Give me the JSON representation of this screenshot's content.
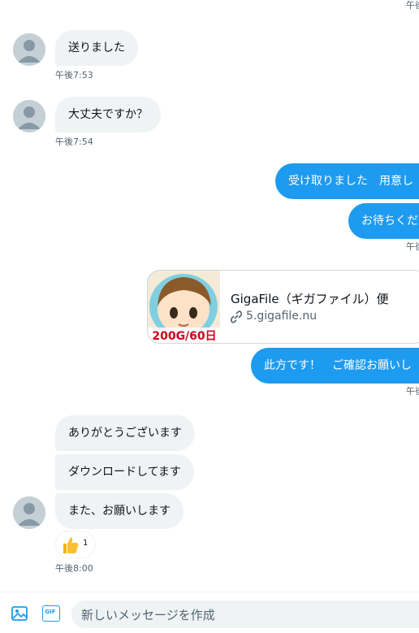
{
  "colors": {
    "accent": "#1d9bf0",
    "incoming_bubble": "#eff3f4",
    "timestamp": "#536471"
  },
  "top_timestamp": "午後",
  "messages": {
    "m1": {
      "text": "送りました",
      "time": "午後7:53"
    },
    "m2": {
      "text": "大丈夫ですか？",
      "time": "午後7:54"
    },
    "m3": {
      "text": "受け取りました　用意し"
    },
    "m4": {
      "text": "お待ちくだ",
      "time": "午後"
    },
    "link_card": {
      "title": "GigaFile（ギガファイル）便",
      "domain": "5.gigafile.nu",
      "thumb_text": "200G/60日",
      "icon": "link-icon"
    },
    "m5": {
      "text": "此方です！　ご確認お願いし",
      "time": "午後"
    },
    "m6": {
      "text": "ありがとうございます"
    },
    "m7": {
      "text": "ダウンロードしてます"
    },
    "m8": {
      "text": "また、お願いします",
      "time": "午後8:00"
    },
    "reaction": {
      "emoji_icon": "thumbs-up-icon",
      "count": "1"
    }
  },
  "composer": {
    "placeholder": "新しいメッセージを作成",
    "image_icon": "image-icon",
    "gif_icon": "gif-icon",
    "gif_label": "GIF"
  }
}
